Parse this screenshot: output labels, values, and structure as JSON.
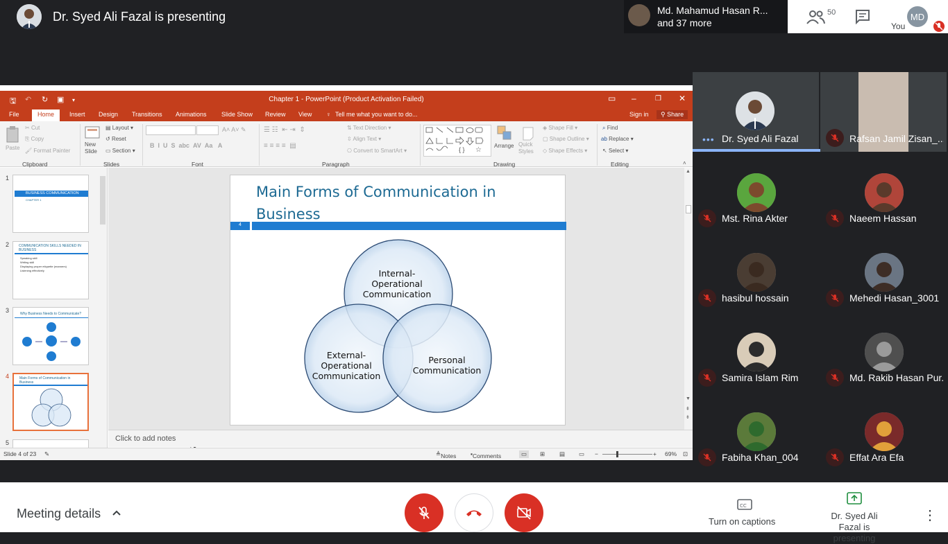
{
  "meet": {
    "presenting_banner": "Dr. Syed Ali Fazal is presenting",
    "people_chip": {
      "line1": "Md. Mahamud Hasan R...",
      "line2": "and 37 more"
    },
    "participant_count": "50",
    "you_label": "You",
    "my_initials": "MD"
  },
  "ppt": {
    "window_title": "Chapter 1 - PowerPoint (Product Activation Failed)",
    "tabs": [
      "File",
      "Home",
      "Insert",
      "Design",
      "Transitions",
      "Animations",
      "Slide Show",
      "Review",
      "View"
    ],
    "tell_me": "Tell me what you want to do...",
    "sign_in": "Sign in",
    "share": "Share",
    "ribbon": {
      "paste": "Paste",
      "cut": "Cut",
      "copy": "Copy",
      "format_painter": "Format Painter",
      "clipboard": "Clipboard",
      "new_slide": "New Slide",
      "layout": "Layout",
      "reset": "Reset",
      "section": "Section",
      "slides": "Slides",
      "font": "Font",
      "text_direction": "Text Direction",
      "align_text": "Align Text",
      "convert_smartart": "Convert to SmartArt",
      "paragraph": "Paragraph",
      "arrange": "Arrange",
      "quick_styles": "Quick Styles",
      "shape_fill": "Shape Fill",
      "shape_outline": "Shape Outline",
      "shape_effects": "Shape Effects",
      "drawing": "Drawing",
      "find": "Find",
      "replace": "Replace",
      "select": "Select",
      "editing": "Editing"
    },
    "thumbnails": [
      {
        "num": "1",
        "title": "BUSINESS COMMUNICATION",
        "sub": "CHAPTER 1"
      },
      {
        "num": "2",
        "title": "COMMUNICATION SKILLS NEEDED IN BUSINESS",
        "bullets": [
          "Speaking skill",
          "Writing skill",
          "Displaying proper etiquette (manners)",
          "Listening effectively"
        ]
      },
      {
        "num": "3",
        "title": "Why Business Needs to Communicate?"
      },
      {
        "num": "4",
        "title": "Main Forms of Communication in Business"
      },
      {
        "num": "5"
      }
    ],
    "slide": {
      "title": "Main Forms of Communication in Business",
      "number": "4",
      "circles": [
        "Internal-Operational Communication",
        "External-Operational Communication",
        "Personal Communication"
      ]
    },
    "notes_placeholder": "Click to add notes",
    "status": {
      "slide_of": "Slide 4 of 23",
      "notes": "Notes",
      "comments": "Comments",
      "zoom": "69%"
    }
  },
  "participants": [
    {
      "name": "Dr. Syed Ali Fazal",
      "speaking": true
    },
    {
      "name": "Rafsan Jamil Zisan_...",
      "muted": true
    },
    {
      "name": "Mst. Rina Akter",
      "muted": true
    },
    {
      "name": "Naeem Hassan",
      "muted": true
    },
    {
      "name": "hasibul hossain",
      "muted": true
    },
    {
      "name": "Mehedi Hasan_3001",
      "muted": true
    },
    {
      "name": "Samira Islam Rim",
      "muted": true
    },
    {
      "name": "Md. Rakib Hasan Pur...",
      "muted": true
    },
    {
      "name": "Fabiha Khan_004",
      "muted": true
    },
    {
      "name": "Effat Ara Efa",
      "muted": true
    }
  ],
  "bottom": {
    "meeting_details": "Meeting details",
    "captions": "Turn on captions",
    "presenting": "Dr. Syed Ali Fazal is presenting"
  },
  "colors": {
    "ppt_accent": "#c43e1c",
    "slide_title": "#1d6a93",
    "slide_bar": "#1f7cd1",
    "meet_red": "#d93025",
    "speaking_accent": "#8ab4f8"
  }
}
